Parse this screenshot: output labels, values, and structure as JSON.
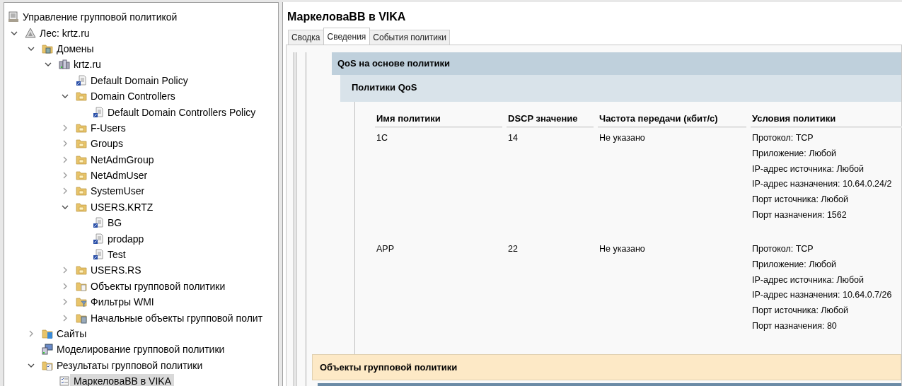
{
  "tree": {
    "label": "Управление групповой политикой",
    "kind": "console",
    "selected": false,
    "children": [
      {
        "label": "Лес: krtz.ru",
        "kind": "forest",
        "expanded": true,
        "selected": false,
        "children": [
          {
            "label": "Домены",
            "kind": "domains",
            "expanded": true,
            "selected": false,
            "children": [
              {
                "label": "krtz.ru",
                "kind": "domain",
                "expanded": true,
                "selected": false,
                "children": [
                  {
                    "label": "Default Domain Policy",
                    "kind": "gpo-link",
                    "selected": false
                  },
                  {
                    "label": "Domain Controllers",
                    "kind": "ou",
                    "expanded": true,
                    "selected": false,
                    "children": [
                      {
                        "label": "Default Domain Controllers Policy",
                        "kind": "gpo-link",
                        "selected": false
                      }
                    ]
                  },
                  {
                    "label": "F-Users",
                    "kind": "ou",
                    "expanded": false,
                    "selected": false
                  },
                  {
                    "label": "Groups",
                    "kind": "ou",
                    "expanded": false,
                    "selected": false
                  },
                  {
                    "label": "NetAdmGroup",
                    "kind": "ou",
                    "expanded": false,
                    "selected": false
                  },
                  {
                    "label": "NetAdmUser",
                    "kind": "ou",
                    "expanded": false,
                    "selected": false
                  },
                  {
                    "label": "SystemUser",
                    "kind": "ou",
                    "expanded": false,
                    "selected": false
                  },
                  {
                    "label": "USERS.KRTZ",
                    "kind": "ou",
                    "expanded": true,
                    "selected": false,
                    "children": [
                      {
                        "label": "BG",
                        "kind": "gpo-link",
                        "selected": false
                      },
                      {
                        "label": "prodapp",
                        "kind": "gpo-link",
                        "selected": false
                      },
                      {
                        "label": "Test",
                        "kind": "gpo-link",
                        "selected": false
                      }
                    ]
                  },
                  {
                    "label": "USERS.RS",
                    "kind": "ou",
                    "expanded": false,
                    "selected": false
                  },
                  {
                    "label": "Объекты групповой политики",
                    "kind": "gpo-folder",
                    "expanded": false,
                    "selected": false
                  },
                  {
                    "label": "Фильтры WMI",
                    "kind": "wmi-folder",
                    "expanded": false,
                    "selected": false
                  },
                  {
                    "label": "Начальные объекты групповой полит",
                    "kind": "starter-folder",
                    "expanded": false,
                    "selected": false
                  }
                ]
              }
            ]
          },
          {
            "label": "Сайты",
            "kind": "sites",
            "expanded": false,
            "selected": false
          },
          {
            "label": "Моделирование групповой политики",
            "kind": "modeling",
            "selected": false
          },
          {
            "label": "Результаты групповой политики",
            "kind": "results",
            "expanded": true,
            "selected": false,
            "children": [
              {
                "label": "МаркеловаBB в VIKA",
                "kind": "result",
                "selected": true
              }
            ]
          }
        ]
      }
    ]
  },
  "details": {
    "title": "МаркеловаBB в VIKA",
    "tabs": [
      {
        "label": "Сводка",
        "selected": false
      },
      {
        "label": "Сведения",
        "selected": true
      },
      {
        "label": "События политики",
        "selected": false
      }
    ],
    "section": "QoS на основе политики",
    "subsection": "Политики QoS",
    "table": {
      "columns": [
        "Имя политики",
        "DSCP значение",
        "Частота передачи (кбит/с)",
        "Условия политики"
      ],
      "rows": [
        {
          "name": "1C",
          "dscp": "14",
          "rate": "Не указано",
          "conditions": [
            "Протокол: TCP",
            "Приложение: Любой",
            "IP-адрес источника: Любой",
            "IP-адрес назначения: 10.64.0.24/2",
            "Порт источника: Любой",
            "Порт назначения: 1562"
          ]
        },
        {
          "name": "APP",
          "dscp": "22",
          "rate": "Не указано",
          "conditions": [
            "Протокол: TCP",
            "Приложение: Любой",
            "IP-адрес источника: Любой",
            "IP-адрес назначения: 10.64.0.7/26",
            "Порт источника: Любой",
            "Порт назначения: 80"
          ]
        }
      ]
    },
    "next_section": "Объекты групповой политики"
  }
}
